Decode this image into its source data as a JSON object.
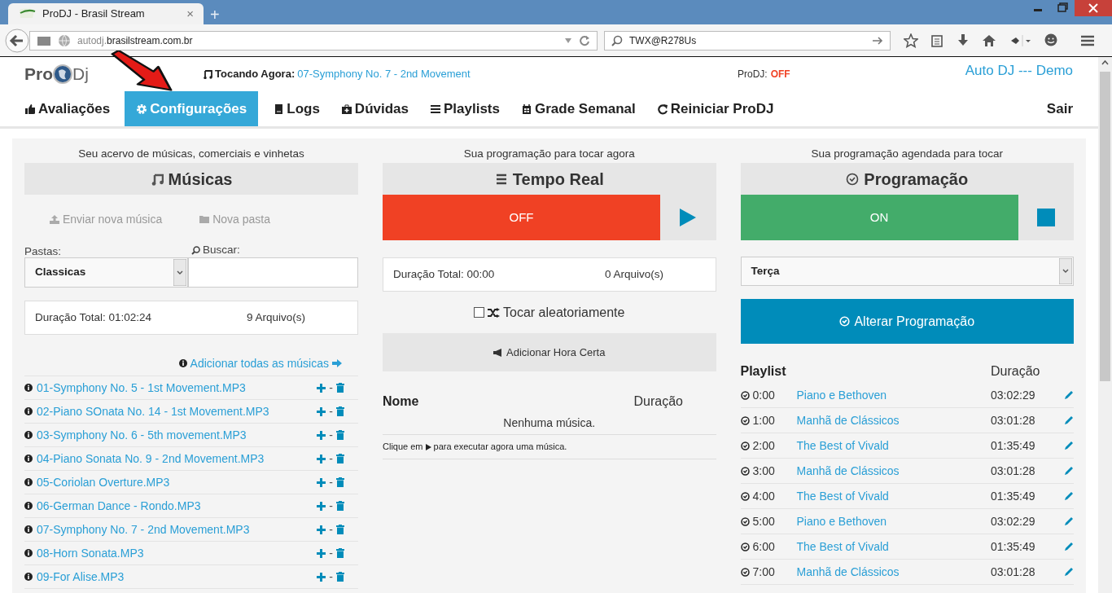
{
  "browser": {
    "tab_title": "ProDJ - Brasil Stream",
    "tab_close": "×",
    "new_tab": "+",
    "url_subdomain": "autodj.",
    "url_domain": "brasilstream.com.br",
    "search_value": "TWX@R278Us"
  },
  "header": {
    "logo_left": "Pro",
    "logo_right": "Dj",
    "now_playing_label": "Tocando Agora:",
    "now_playing": "07-Symphony No. 7 - 2nd Movement",
    "status_label": "ProDJ:",
    "status": "OFF",
    "account": "Auto DJ --- Demo"
  },
  "nav": [
    {
      "label": "Avaliações",
      "kind": "thumb",
      "selected": false
    },
    {
      "label": "Configurações",
      "kind": "gear",
      "selected": true
    },
    {
      "label": "Logs",
      "kind": "doc",
      "selected": false
    },
    {
      "label": "Dúvidas",
      "kind": "kit",
      "selected": false
    },
    {
      "label": "Playlists",
      "kind": "list",
      "selected": false
    },
    {
      "label": "Grade Semanal",
      "kind": "calendar",
      "selected": false
    },
    {
      "label": "Reiniciar ProDJ",
      "kind": "refresh",
      "selected": false
    }
  ],
  "logout": "Sair",
  "library": {
    "caption": "Seu acervo de músicas, comerciais e vinhetas",
    "title": "Músicas",
    "upload": "Enviar nova música",
    "new_folder": "Nova pasta",
    "folders_label": "Pastas:",
    "folder_value": "Classicas",
    "search_label": "Buscar:",
    "total": "Duração Total: 01:02:24",
    "count": "9 Arquivo(s)",
    "add_all": "Adicionar todas as músicas",
    "row_separator": "-",
    "songs": [
      "01-Symphony No. 5 - 1st Movement.MP3",
      "02-Piano SOnata No. 14 - 1st Movement.MP3",
      "03-Symphony No. 6 - 5th movement.MP3",
      "04-Piano Sonata No. 9 - 2nd Movement.MP3",
      "05-Coriolan Overture.MP3",
      "06-German Dance - Rondo.MP3",
      "07-Symphony No. 7 - 2nd Movement.MP3",
      "08-Horn Sonata.MP3",
      "09-For Alise.MP3"
    ]
  },
  "realtime": {
    "caption": "Sua programação para tocar agora",
    "title": "Tempo Real",
    "state": "OFF",
    "total": "Duração Total: 00:00",
    "count": "0 Arquivo(s)",
    "shuffle": {
      "label": "Tocar aleatoriamente",
      "checked": false
    },
    "add_time": "Adicionar Hora Certa",
    "col_name": "Nome",
    "col_duration": "Duração",
    "empty": "Nenhuma música.",
    "hint_before": "Clique em",
    "hint_after": "para executar agora uma música."
  },
  "schedule": {
    "caption": "Sua programação agendada para tocar",
    "title": "Programação",
    "state": "ON",
    "day": "Terça",
    "change_button": "Alterar Programação",
    "col_playlist": "Playlist",
    "col_duration": "Duração",
    "rows": [
      {
        "time": "0:00",
        "name": "Piano e Bethoven",
        "duration": "03:02:29"
      },
      {
        "time": "1:00",
        "name": "Manhã de Clássicos",
        "duration": "03:01:28"
      },
      {
        "time": "2:00",
        "name": "The Best of Vivald",
        "duration": "01:35:49"
      },
      {
        "time": "3:00",
        "name": "Manhã de Clássicos",
        "duration": "03:01:28"
      },
      {
        "time": "4:00",
        "name": "The Best of Vivald",
        "duration": "01:35:49"
      },
      {
        "time": "5:00",
        "name": "Piano e Bethoven",
        "duration": "03:02:29"
      },
      {
        "time": "6:00",
        "name": "The Best of Vivald",
        "duration": "01:35:49"
      },
      {
        "time": "7:00",
        "name": "Manhã de Clássicos",
        "duration": "03:01:28"
      }
    ]
  }
}
